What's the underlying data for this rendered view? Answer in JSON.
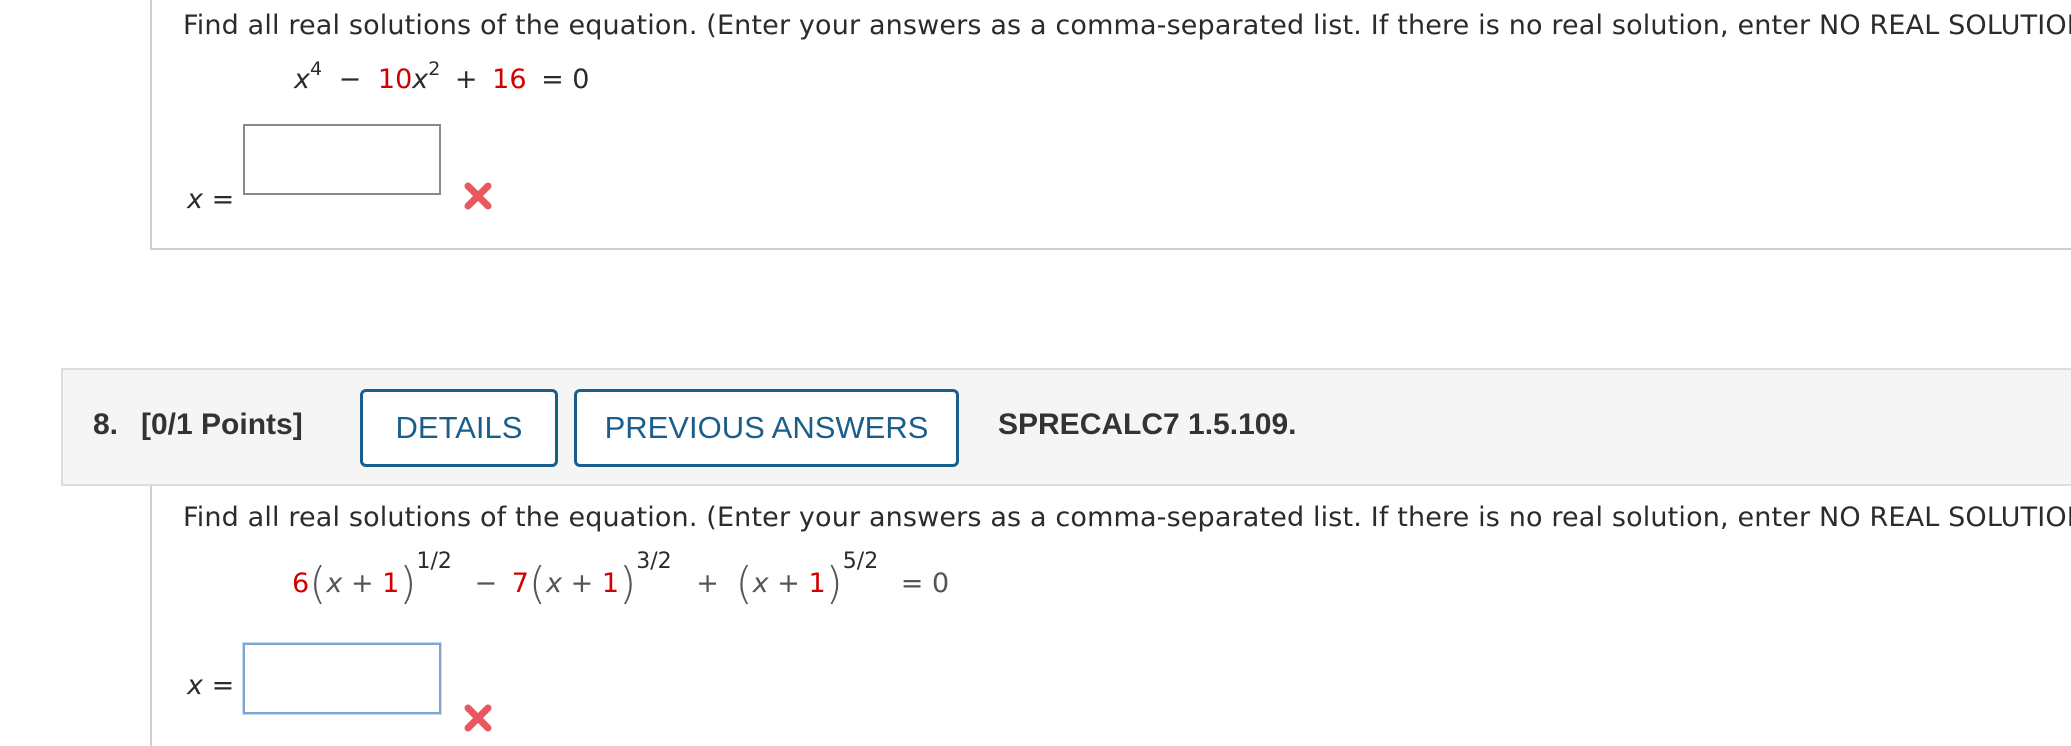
{
  "problem7": {
    "instructions": "Find all real solutions of the equation. (Enter your answers as a comma-separated list. If there is no real solution, enter NO REAL SOLUTION.)",
    "equation": {
      "var1": "x",
      "exp1": "4",
      "minus": "−",
      "coef2": "10",
      "var2": "x",
      "exp2": "2",
      "plus": "+",
      "const": "16",
      "eq": "= 0"
    },
    "answer_label_var": "x",
    "answer_label_eq": "=",
    "answer_value": "",
    "status": "incorrect"
  },
  "problem8": {
    "number": "8.",
    "points": "[0/1 Points]",
    "details_label": "DETAILS",
    "previous_answers_label": "PREVIOUS ANSWERS",
    "source": "SPRECALC7 1.5.109.",
    "instructions": "Find all real solutions of the equation. (Enter your answers as a comma-separated list. If there is no real solution, enter NO REAL SOLUTION.)",
    "equation": {
      "c1": "6",
      "t1_var": "x",
      "t1_plus": "+",
      "t1_const": "1",
      "e1": "1/2",
      "minus": "−",
      "c2": "7",
      "t2_var": "x",
      "t2_plus": "+",
      "t2_const": "1",
      "e2": "3/2",
      "plus": "+",
      "t3_var": "x",
      "t3_plus": "+",
      "t3_const": "1",
      "e3": "5/2",
      "eq": "= 0"
    },
    "answer_label_var": "x",
    "answer_label_eq": "=",
    "answer_value": "",
    "status": "incorrect"
  },
  "colors": {
    "accent_blue": "#1a5e8c",
    "highlight_red": "#d10000",
    "incorrect_mark": "#e8585e"
  },
  "icons": [
    "incorrect-x-icon"
  ]
}
